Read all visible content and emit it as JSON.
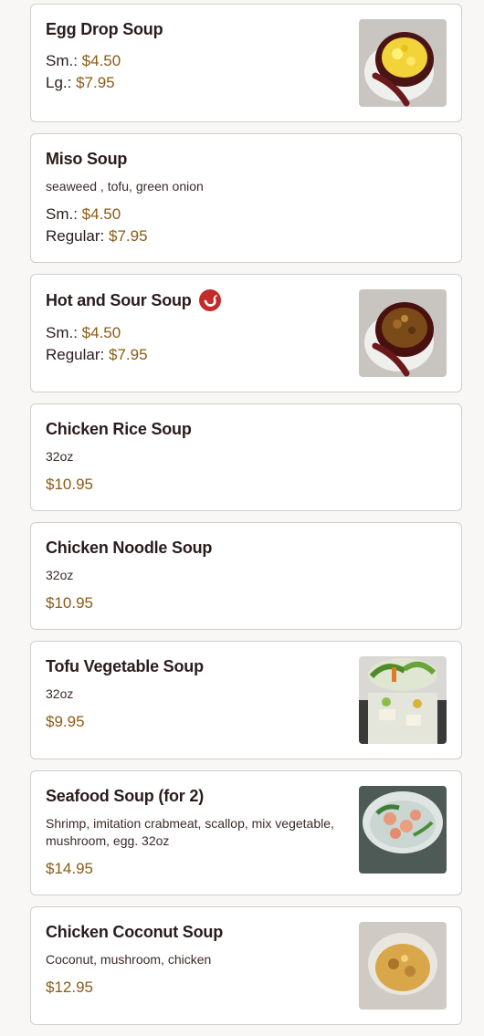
{
  "colors": {
    "price": "#8b5a16",
    "title": "#2b1c1c",
    "spicy_badge": "#c42b2b",
    "card_border": "#cfcfcf"
  },
  "menu_items": [
    {
      "name": "Egg Drop Soup",
      "description": "",
      "spicy": false,
      "image": "egg-drop-soup-photo",
      "prices": [
        {
          "label": "Sm.: ",
          "amount": "$4.50"
        },
        {
          "label": "Lg.: ",
          "amount": "$7.95"
        }
      ]
    },
    {
      "name": "Miso Soup",
      "description": "seaweed , tofu, green onion",
      "spicy": false,
      "image": "",
      "prices": [
        {
          "label": "Sm.: ",
          "amount": "$4.50"
        },
        {
          "label": "Regular: ",
          "amount": "$7.95"
        }
      ]
    },
    {
      "name": "Hot and Sour Soup",
      "description": "",
      "spicy": true,
      "image": "hot-and-sour-soup-photo",
      "prices": [
        {
          "label": "Sm.: ",
          "amount": "$4.50"
        },
        {
          "label": "Regular: ",
          "amount": "$7.95"
        }
      ]
    },
    {
      "name": "Chicken Rice Soup",
      "description": "32oz",
      "spicy": false,
      "image": "",
      "prices": [
        {
          "label": "",
          "amount": "$10.95"
        }
      ]
    },
    {
      "name": "Chicken Noodle Soup",
      "description": "32oz",
      "spicy": false,
      "image": "",
      "prices": [
        {
          "label": "",
          "amount": "$10.95"
        }
      ]
    },
    {
      "name": "Tofu Vegetable Soup",
      "description": "32oz",
      "spicy": false,
      "image": "tofu-vegetable-soup-photo",
      "prices": [
        {
          "label": "",
          "amount": "$9.95"
        }
      ]
    },
    {
      "name": "Seafood Soup (for 2)",
      "description": "Shrimp, imitation crabmeat, scallop, mix vegetable, mushroom, egg. 32oz",
      "spicy": false,
      "image": "seafood-soup-photo",
      "prices": [
        {
          "label": "",
          "amount": "$14.95"
        }
      ]
    },
    {
      "name": "Chicken Coconut Soup",
      "description": "Coconut, mushroom, chicken",
      "spicy": false,
      "image": "chicken-coconut-soup-photo",
      "prices": [
        {
          "label": "",
          "amount": "$12.95"
        }
      ]
    }
  ]
}
